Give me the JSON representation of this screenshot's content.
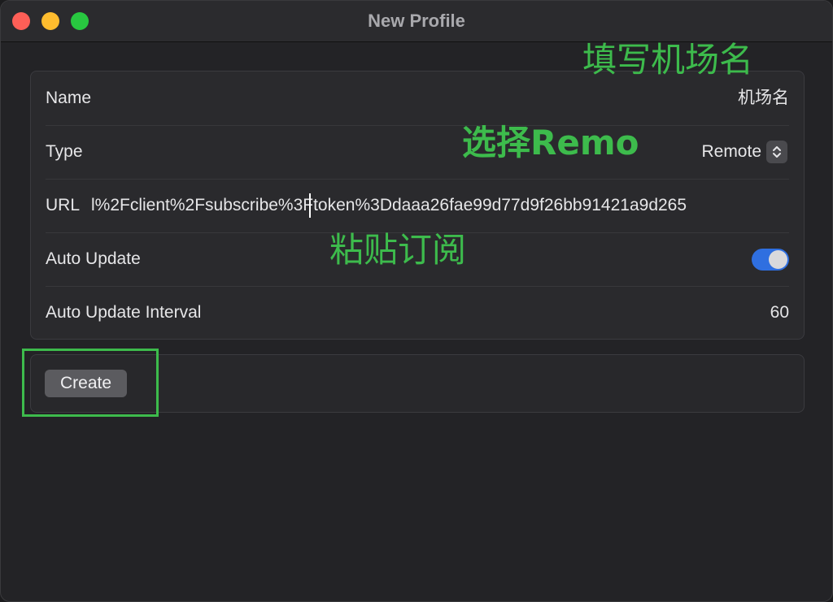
{
  "window": {
    "title": "New Profile"
  },
  "form": {
    "name": {
      "label": "Name",
      "value": "机场名"
    },
    "type": {
      "label": "Type",
      "value": "Remote"
    },
    "url": {
      "label": "URL",
      "value": "l%2Fclient%2Fsubscribe%3Ftoken%3Ddaaa26fae99d77d9f26bb91421a9d265"
    },
    "auto_update": {
      "label": "Auto Update",
      "enabled": true
    },
    "auto_update_interval": {
      "label": "Auto Update Interval",
      "value": "60"
    }
  },
  "actions": {
    "create_label": "Create"
  },
  "annotations": {
    "name_hint": "填写机场名",
    "type_hint": "选择Remo",
    "url_hint": "粘贴订阅"
  },
  "colors": {
    "traffic_close": "#fe5f57",
    "traffic_minimize": "#febc2e",
    "traffic_zoom": "#28c840",
    "toggle_on": "#2f6fe0",
    "annotation_green": "#3dbb4c"
  },
  "icons": {
    "type_popup": "chevron-up-down-icon"
  }
}
